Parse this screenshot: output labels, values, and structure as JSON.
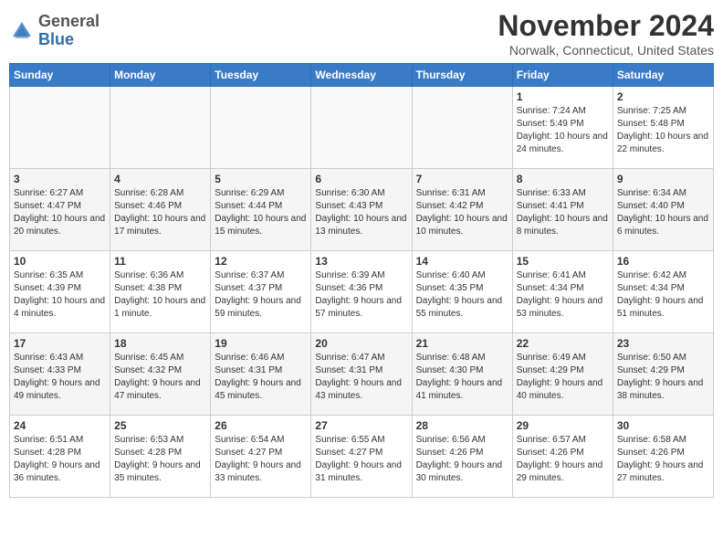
{
  "header": {
    "logo_line1": "General",
    "logo_line2": "Blue",
    "month_title": "November 2024",
    "location": "Norwalk, Connecticut, United States"
  },
  "weekdays": [
    "Sunday",
    "Monday",
    "Tuesday",
    "Wednesday",
    "Thursday",
    "Friday",
    "Saturday"
  ],
  "weeks": [
    [
      {
        "day": "",
        "info": ""
      },
      {
        "day": "",
        "info": ""
      },
      {
        "day": "",
        "info": ""
      },
      {
        "day": "",
        "info": ""
      },
      {
        "day": "",
        "info": ""
      },
      {
        "day": "1",
        "info": "Sunrise: 7:24 AM\nSunset: 5:49 PM\nDaylight: 10 hours and 24 minutes."
      },
      {
        "day": "2",
        "info": "Sunrise: 7:25 AM\nSunset: 5:48 PM\nDaylight: 10 hours and 22 minutes."
      }
    ],
    [
      {
        "day": "3",
        "info": "Sunrise: 6:27 AM\nSunset: 4:47 PM\nDaylight: 10 hours and 20 minutes."
      },
      {
        "day": "4",
        "info": "Sunrise: 6:28 AM\nSunset: 4:46 PM\nDaylight: 10 hours and 17 minutes."
      },
      {
        "day": "5",
        "info": "Sunrise: 6:29 AM\nSunset: 4:44 PM\nDaylight: 10 hours and 15 minutes."
      },
      {
        "day": "6",
        "info": "Sunrise: 6:30 AM\nSunset: 4:43 PM\nDaylight: 10 hours and 13 minutes."
      },
      {
        "day": "7",
        "info": "Sunrise: 6:31 AM\nSunset: 4:42 PM\nDaylight: 10 hours and 10 minutes."
      },
      {
        "day": "8",
        "info": "Sunrise: 6:33 AM\nSunset: 4:41 PM\nDaylight: 10 hours and 8 minutes."
      },
      {
        "day": "9",
        "info": "Sunrise: 6:34 AM\nSunset: 4:40 PM\nDaylight: 10 hours and 6 minutes."
      }
    ],
    [
      {
        "day": "10",
        "info": "Sunrise: 6:35 AM\nSunset: 4:39 PM\nDaylight: 10 hours and 4 minutes."
      },
      {
        "day": "11",
        "info": "Sunrise: 6:36 AM\nSunset: 4:38 PM\nDaylight: 10 hours and 1 minute."
      },
      {
        "day": "12",
        "info": "Sunrise: 6:37 AM\nSunset: 4:37 PM\nDaylight: 9 hours and 59 minutes."
      },
      {
        "day": "13",
        "info": "Sunrise: 6:39 AM\nSunset: 4:36 PM\nDaylight: 9 hours and 57 minutes."
      },
      {
        "day": "14",
        "info": "Sunrise: 6:40 AM\nSunset: 4:35 PM\nDaylight: 9 hours and 55 minutes."
      },
      {
        "day": "15",
        "info": "Sunrise: 6:41 AM\nSunset: 4:34 PM\nDaylight: 9 hours and 53 minutes."
      },
      {
        "day": "16",
        "info": "Sunrise: 6:42 AM\nSunset: 4:34 PM\nDaylight: 9 hours and 51 minutes."
      }
    ],
    [
      {
        "day": "17",
        "info": "Sunrise: 6:43 AM\nSunset: 4:33 PM\nDaylight: 9 hours and 49 minutes."
      },
      {
        "day": "18",
        "info": "Sunrise: 6:45 AM\nSunset: 4:32 PM\nDaylight: 9 hours and 47 minutes."
      },
      {
        "day": "19",
        "info": "Sunrise: 6:46 AM\nSunset: 4:31 PM\nDaylight: 9 hours and 45 minutes."
      },
      {
        "day": "20",
        "info": "Sunrise: 6:47 AM\nSunset: 4:31 PM\nDaylight: 9 hours and 43 minutes."
      },
      {
        "day": "21",
        "info": "Sunrise: 6:48 AM\nSunset: 4:30 PM\nDaylight: 9 hours and 41 minutes."
      },
      {
        "day": "22",
        "info": "Sunrise: 6:49 AM\nSunset: 4:29 PM\nDaylight: 9 hours and 40 minutes."
      },
      {
        "day": "23",
        "info": "Sunrise: 6:50 AM\nSunset: 4:29 PM\nDaylight: 9 hours and 38 minutes."
      }
    ],
    [
      {
        "day": "24",
        "info": "Sunrise: 6:51 AM\nSunset: 4:28 PM\nDaylight: 9 hours and 36 minutes."
      },
      {
        "day": "25",
        "info": "Sunrise: 6:53 AM\nSunset: 4:28 PM\nDaylight: 9 hours and 35 minutes."
      },
      {
        "day": "26",
        "info": "Sunrise: 6:54 AM\nSunset: 4:27 PM\nDaylight: 9 hours and 33 minutes."
      },
      {
        "day": "27",
        "info": "Sunrise: 6:55 AM\nSunset: 4:27 PM\nDaylight: 9 hours and 31 minutes."
      },
      {
        "day": "28",
        "info": "Sunrise: 6:56 AM\nSunset: 4:26 PM\nDaylight: 9 hours and 30 minutes."
      },
      {
        "day": "29",
        "info": "Sunrise: 6:57 AM\nSunset: 4:26 PM\nDaylight: 9 hours and 29 minutes."
      },
      {
        "day": "30",
        "info": "Sunrise: 6:58 AM\nSunset: 4:26 PM\nDaylight: 9 hours and 27 minutes."
      }
    ]
  ]
}
